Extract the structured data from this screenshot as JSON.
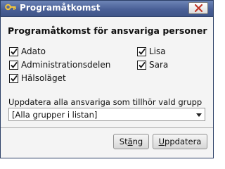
{
  "window": {
    "title": "Programåtkomst"
  },
  "heading": "Programåtkomst för ansvariga personer",
  "groups": [
    {
      "label": "Adato",
      "checked": true
    },
    {
      "label": "Administrationsdelen",
      "checked": true
    },
    {
      "label": "Hälsoläget",
      "checked": true
    }
  ],
  "persons": [
    {
      "label": "Lisa",
      "checked": true
    },
    {
      "label": "Sara",
      "checked": true
    }
  ],
  "update_group": {
    "label": "Uppdatera alla ansvariga som tillhör vald grupp",
    "selected": "[Alla grupper i listan]"
  },
  "buttons": {
    "close_pre": "St",
    "close_mnemonic": "ä",
    "close_post": "ng",
    "update_pre": "",
    "update_mnemonic": "U",
    "update_post": "ppdatera"
  },
  "icons": {
    "title": "key-icon",
    "close": "close-x-icon",
    "check": "checkmark-icon",
    "dropdown": "chevron-down-icon"
  }
}
